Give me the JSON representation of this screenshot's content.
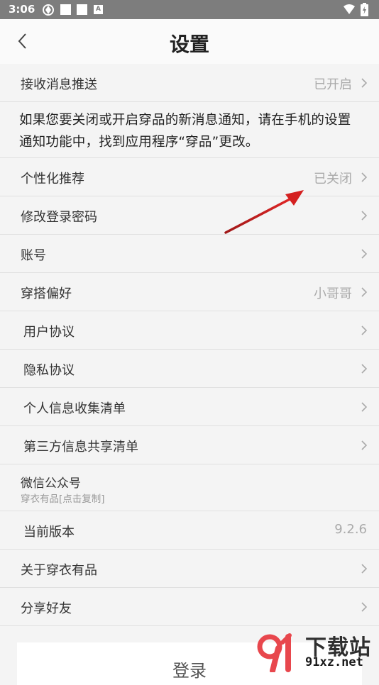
{
  "status_bar": {
    "time": "3:06"
  },
  "header": {
    "title": "设置",
    "back_icon": "chevron-left-icon"
  },
  "push": {
    "label": "接收消息推送",
    "value": "已开启"
  },
  "notice": {
    "text": "如果您要关闭或开启穿品的新消息通知，请在手机的设置 通知功能中，找到应用程序“穿品”更改。"
  },
  "rows": [
    {
      "label": "个性化推荐",
      "value": "已关闭"
    },
    {
      "label": "修改登录密码",
      "value": ""
    },
    {
      "label": "账号",
      "value": ""
    },
    {
      "label": "穿搭偏好",
      "value": "小哥哥"
    },
    {
      "label": "用户协议",
      "value": ""
    },
    {
      "label": "隐私协议",
      "value": ""
    },
    {
      "label": "个人信息收集清单",
      "value": ""
    },
    {
      "label": "第三方信息共享清单",
      "value": ""
    }
  ],
  "wechat": {
    "label": "微信公众号",
    "sub": "穿衣有品[点击复制]"
  },
  "version": {
    "label": "当前版本",
    "value": "9.2.6"
  },
  "about": {
    "label": "关于穿衣有品"
  },
  "share": {
    "label": "分享好友"
  },
  "login_button": {
    "label": "登录"
  },
  "watermark": {
    "text": "下载站",
    "url_text": "91xz.net"
  },
  "colors": {
    "status_bar": "#7d7d7d",
    "background": "#f4f4f4",
    "annotation_arrow": "#d42020"
  }
}
